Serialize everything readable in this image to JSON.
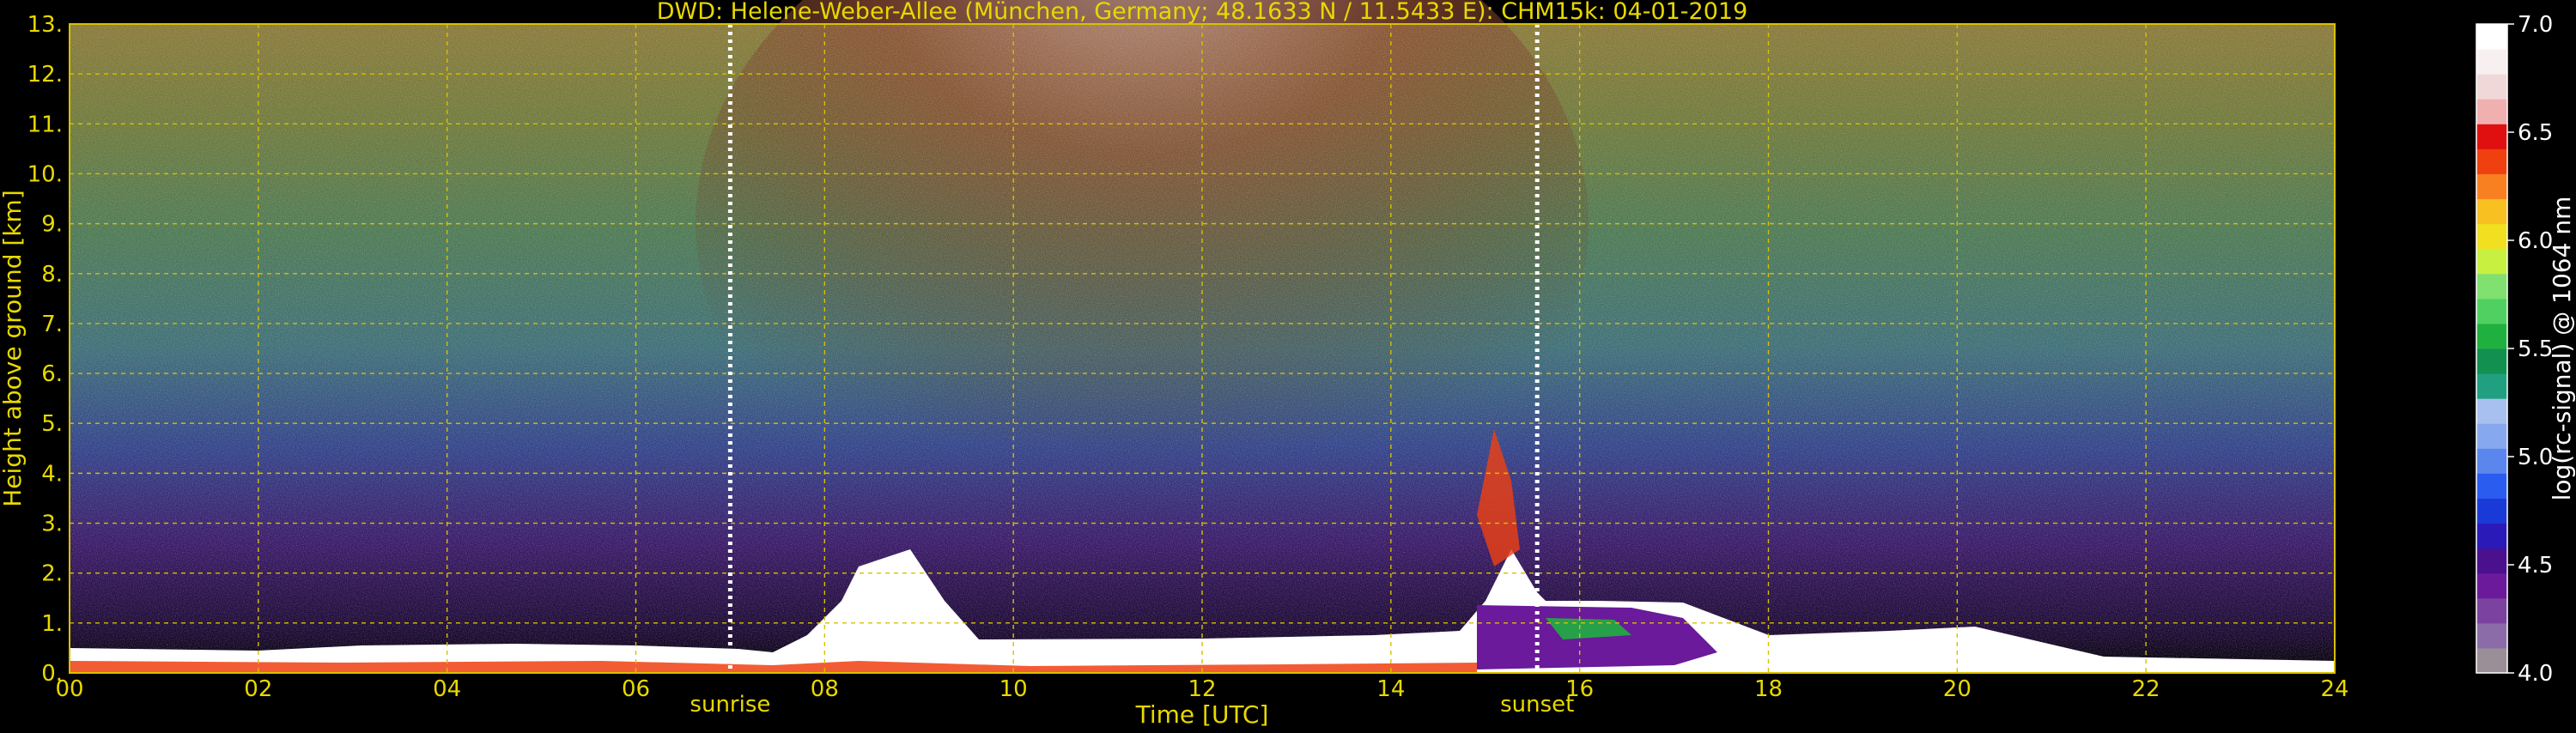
{
  "chart_data": {
    "type": "heatmap",
    "title": "DWD: Helene-Weber-Allee (München, Germany; 48.1633 N / 11.5433 E):    CHM15k: 04-01-2019",
    "xlabel": "Time [UTC]",
    "ylabel": "Height above ground [km]",
    "xlim": [
      0,
      24
    ],
    "ylim": [
      0,
      13
    ],
    "x_ticks": [
      "00",
      "02",
      "04",
      "06",
      "08",
      "10",
      "12",
      "14",
      "16",
      "18",
      "20",
      "22",
      "24"
    ],
    "y_ticks": [
      "0.",
      "1.",
      "2.",
      "3.",
      "4.",
      "5.",
      "6.",
      "7.",
      "8.",
      "9.",
      "10.",
      "11.",
      "12.",
      "13."
    ],
    "grid": true,
    "annotations": [
      {
        "label": "sunrise",
        "x": 7.0
      },
      {
        "label": "sunset",
        "x": 15.55
      }
    ],
    "colorbar": {
      "label": "log(rc-signal) @ 1064 nm",
      "range": [
        4.0,
        7.0
      ],
      "ticks": [
        "4.0",
        "4.5",
        "5.0",
        "5.5",
        "6.0",
        "6.5",
        "7.0"
      ],
      "colors": [
        "#9a8f96",
        "#8c6ca8",
        "#7b42a0",
        "#6a1a9a",
        "#4b108e",
        "#2a1ab8",
        "#1a3ad8",
        "#2a5cf0",
        "#5a86ee",
        "#86a8ee",
        "#a8c0f0",
        "#20a080",
        "#129050",
        "#20b040",
        "#50d060",
        "#80e070",
        "#c8f040",
        "#f0e020",
        "#f8c020",
        "#f88020",
        "#f04010",
        "#e01010",
        "#f0b0b0",
        "#f0d8d8",
        "#f8f0f0",
        "#ffffff"
      ]
    }
  }
}
